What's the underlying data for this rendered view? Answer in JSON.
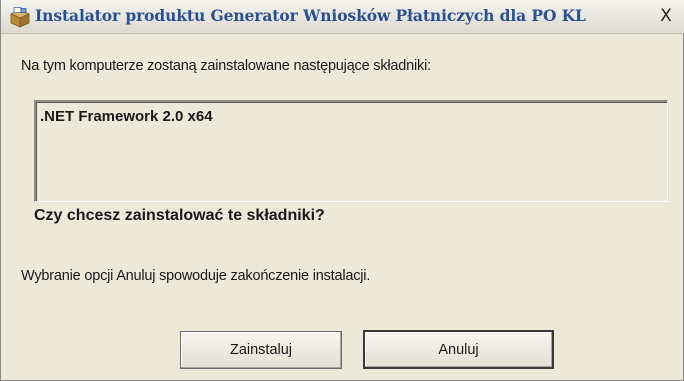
{
  "window": {
    "title": "Instalator produktu Generator Wniosków Płatniczych dla PO KL",
    "close_symbol": "X",
    "icon": "installer-box-icon"
  },
  "dialog": {
    "intro": "Na tym komputerze zostaną zainstalowane następujące składniki:",
    "components": [
      ".NET Framework 2.0 x64"
    ],
    "question": "Czy chcesz zainstalować te składniki?",
    "cancel_info": "Wybranie opcji Anuluj spowoduje zakończenie instalacji."
  },
  "buttons": {
    "install_label": "Zainstaluj",
    "cancel_label": "Anuluj"
  }
}
